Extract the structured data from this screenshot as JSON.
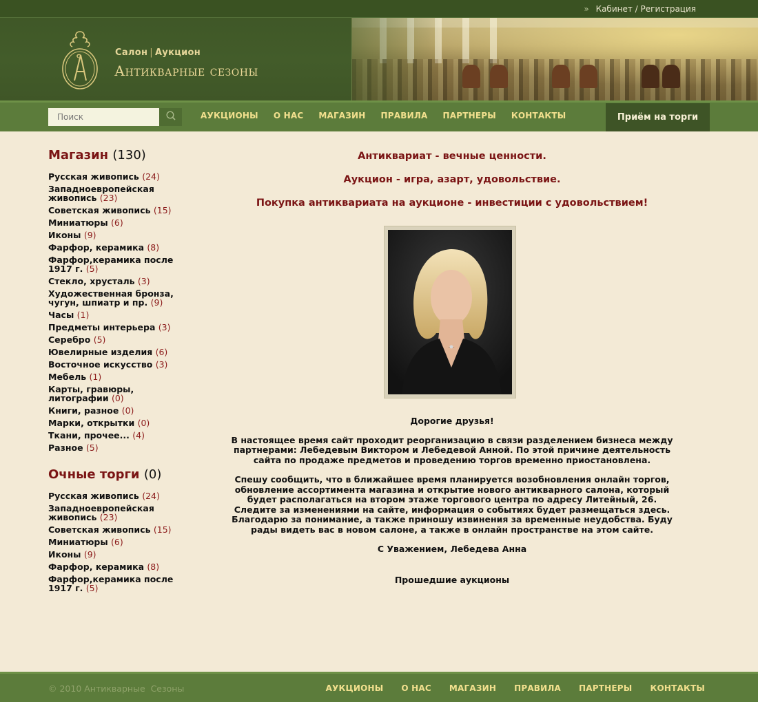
{
  "header": {
    "top_links": "Кабинет / Регистрация",
    "brand_top_left": "Салон",
    "brand_top_right": "Аукцион",
    "brand_title": "Антикварные сезоны"
  },
  "nav": {
    "search_placeholder": "Поиск",
    "items": [
      "АУКЦИОНЫ",
      "О НАС",
      "МАГАЗИН",
      "ПРАВИЛА",
      "ПАРТНЕРЫ",
      "КОНТАКТЫ"
    ],
    "cta": "Приём на торги"
  },
  "sidebar": {
    "shop": {
      "title": "Магазин",
      "count": "(130)",
      "items": [
        {
          "label": "Русская живопись",
          "count": "(24)"
        },
        {
          "label": "Западноевропейская живопись",
          "count": "(23)"
        },
        {
          "label": "Советская живопись",
          "count": "(15)"
        },
        {
          "label": "Миниатюры",
          "count": "(6)"
        },
        {
          "label": "Иконы",
          "count": "(9)"
        },
        {
          "label": "Фарфор, керамика",
          "count": "(8)"
        },
        {
          "label": "Фарфор,керамика после 1917 г.",
          "count": "(5)"
        },
        {
          "label": "Стекло, хрусталь",
          "count": "(3)"
        },
        {
          "label": "Художественная бронза, чугун, шпиатр и пр.",
          "count": "(9)"
        },
        {
          "label": "Часы",
          "count": "(1)"
        },
        {
          "label": "Предметы интерьера",
          "count": "(3)"
        },
        {
          "label": "Серебро",
          "count": "(5)"
        },
        {
          "label": "Ювелирные изделия",
          "count": "(6)"
        },
        {
          "label": "Восточное искусство",
          "count": "(3)"
        },
        {
          "label": "Мебель",
          "count": "(1)"
        },
        {
          "label": "Карты, гравюры, литографии",
          "count": "(0)"
        },
        {
          "label": "Книги, разное",
          "count": "(0)"
        },
        {
          "label": "Марки, открытки",
          "count": "(0)"
        },
        {
          "label": "Ткани, прочее...",
          "count": "(4)"
        },
        {
          "label": "Разное",
          "count": "(5)"
        }
      ]
    },
    "live": {
      "title": "Очные торги",
      "count": "(0)",
      "items": [
        {
          "label": "Русская живопись",
          "count": "(24)"
        },
        {
          "label": "Западноевропейская живопись",
          "count": "(23)"
        },
        {
          "label": "Советская живопись",
          "count": "(15)"
        },
        {
          "label": "Миниатюры",
          "count": "(6)"
        },
        {
          "label": "Иконы",
          "count": "(9)"
        },
        {
          "label": "Фарфор, керамика",
          "count": "(8)"
        },
        {
          "label": "Фарфор,керамика после 1917 г.",
          "count": "(5)"
        }
      ]
    }
  },
  "main": {
    "slogans": [
      "Антиквариат - вечные ценности.",
      "Аукцион - игра, азарт, удовольствие.",
      "Покупка антиквариата на аукционе - инвестиции с удовольствием!"
    ],
    "greeting": "Дорогие друзья!",
    "paragraph1": "В настоящее время сайт проходит реорганизацию в связи разделением бизнеса между партнерами: Лебедевым Виктором и Лебедевой Анной. По этой причине деятельность сайта по продаже предметов и проведению торгов временно приостановлена.",
    "paragraph2": "Спешу сообщить, что в ближайшее время планируется возобновления онлайн торгов, обновление ассортимента магазина и открытие нового антикварного салона, который будет располагаться на втором этаже торгового центра по адресу Литейный, 26. Следите за изменениями на сайте, информация о событиях будет размещаться здесь. Благодарю за понимание, а также приношу извинения за временные неудобства. Буду рады видеть вас в новом салоне, а также в онлайн пространстве на этом сайте.",
    "signature": "С Уважением, Лебедева Анна",
    "past_auctions": "Прошедшие аукционы"
  },
  "footer": {
    "copyright": "© 2010 Антикварные  Сезоны",
    "items": [
      "АУКЦИОНЫ",
      "О НАС",
      "МАГАЗИН",
      "ПРАВИЛА",
      "ПАРТНЕРЫ",
      "КОНТАКТЫ"
    ]
  },
  "icons": {
    "search": "search-icon",
    "logo": "monogram-logo-icon"
  },
  "colors": {
    "header_green": "#435c2a",
    "nav_green": "#5c7c3b",
    "accent_gold": "#f2e08e",
    "title_red": "#7a1414",
    "background": "#f3ead6"
  }
}
